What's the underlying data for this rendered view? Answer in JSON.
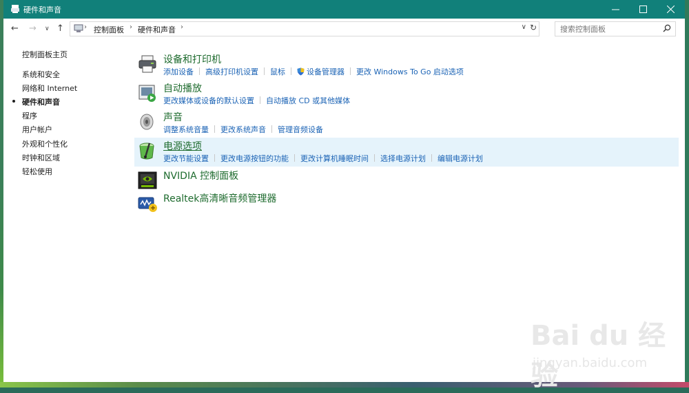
{
  "window": {
    "title": "硬件和声音"
  },
  "address": {
    "crumbs": [
      "控制面板",
      "硬件和声音"
    ]
  },
  "search": {
    "placeholder": "搜索控制面板"
  },
  "leftnav": {
    "home": "控制面板主页",
    "items": [
      {
        "label": "系统和安全"
      },
      {
        "label": "网络和 Internet"
      },
      {
        "label": "硬件和声音",
        "active": true
      },
      {
        "label": "程序"
      },
      {
        "label": "用户帐户"
      },
      {
        "label": "外观和个性化"
      },
      {
        "label": "时钟和区域"
      },
      {
        "label": "轻松使用"
      }
    ]
  },
  "categories": [
    {
      "title": "设备和打印机",
      "icon": "printer-icon",
      "links": [
        "添加设备",
        "高级打印机设置",
        "鼠标",
        "设备管理器",
        "更改 Windows To Go 启动选项"
      ]
    },
    {
      "title": "自动播放",
      "icon": "autoplay-icon",
      "links": [
        "更改媒体或设备的默认设置",
        "自动播放 CD 或其他媒体"
      ]
    },
    {
      "title": "声音",
      "icon": "speaker-icon",
      "links": [
        "调整系统音量",
        "更改系统声音",
        "管理音频设备"
      ]
    },
    {
      "title": "电源选项",
      "icon": "power-options-icon",
      "highlighted": true,
      "links": [
        "更改节能设置",
        "更改电源按钮的功能",
        "更改计算机睡眠时间",
        "选择电源计划",
        "编辑电源计划"
      ]
    },
    {
      "title": "NVIDIA 控制面板",
      "icon": "nvidia-icon",
      "links": []
    },
    {
      "title": "Realtek高清晰音频管理器",
      "icon": "realtek-icon",
      "links": []
    }
  ],
  "watermark": {
    "main": "Bai du 经验",
    "sub": "jingyan.baidu.com"
  },
  "colors": {
    "titlebar": "#11807a",
    "link": "#1b63b5",
    "category_title": "#1e6b2e",
    "highlight": "#e5f3fb"
  }
}
